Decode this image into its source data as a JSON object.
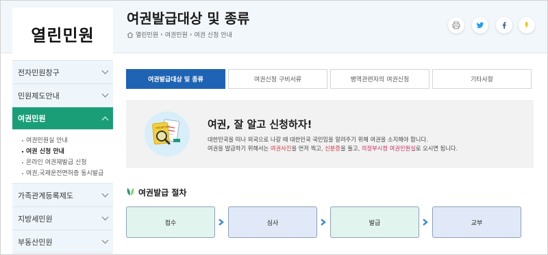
{
  "sidebar": {
    "logo": "열린민원",
    "items": [
      {
        "label": "전자민원창구"
      },
      {
        "label": "민원제도안내"
      },
      {
        "label": "여권민원"
      },
      {
        "label": "가족관계등록제도"
      },
      {
        "label": "지방세민원"
      },
      {
        "label": "부동산민원"
      }
    ],
    "sub_items": [
      {
        "label": "여권민원실 안내"
      },
      {
        "label": "여권 신청 안내"
      },
      {
        "label": "온라인 여권재발급 신청"
      },
      {
        "label": "여권,국제운전면허증 동시발급"
      }
    ]
  },
  "header": {
    "title": "여권발급대상 및 종류",
    "breadcrumb": [
      "열린민원",
      "여권민원",
      "여권 신청 안내"
    ],
    "breadcrumb_sep": "›",
    "social": {
      "print_icon": "printer-icon",
      "twitter_icon": "twitter-icon",
      "facebook_icon": "facebook-icon",
      "kakao_icon": "kakao-icon"
    }
  },
  "tabs": [
    {
      "label": "여권발급대상 및 종류",
      "active": true
    },
    {
      "label": "여권신청 구비서류",
      "active": false
    },
    {
      "label": "병역관련자의 여권신청",
      "active": false
    },
    {
      "label": "기타사항",
      "active": false
    }
  ],
  "info": {
    "heading": "여권, 잘 알고 신청하자!",
    "line1": "대한민국을 떠나 외국으로 나갈 때 대한민국 국민임을 알려주기 위해 여권을 소지해야 합니다.",
    "line2_a": "여권을 발급하기 위해서는 ",
    "line2_b": "여권사진",
    "line2_c": "을 먼저 찍고, ",
    "line2_d": "신분증",
    "line2_e": "을 들고, ",
    "line2_f": "의정부시청 여권민원실",
    "line2_g": "로 오시면 됩니다.",
    "illustration_text": "PASSPORT"
  },
  "procedure": {
    "heading": "여권발급 절차",
    "steps": [
      {
        "label": "접수"
      },
      {
        "label": "심사"
      },
      {
        "label": "발급"
      },
      {
        "label": "교부"
      }
    ]
  },
  "colors": {
    "accent_green": "#1a9e78",
    "tab_blue": "#1f63b4",
    "twitter": "#1da1f2",
    "facebook": "#3b5998",
    "kakao": "#f2c200"
  }
}
